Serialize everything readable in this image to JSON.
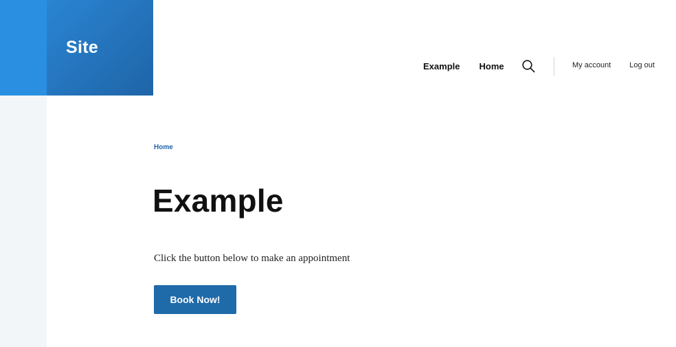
{
  "header": {
    "brand": "Site",
    "main_nav": [
      {
        "label": "Example"
      },
      {
        "label": "Home"
      }
    ],
    "search_icon": "search-icon",
    "account_nav": [
      {
        "label": "My account"
      },
      {
        "label": "Log out"
      }
    ]
  },
  "breadcrumb": {
    "home": "Home"
  },
  "main": {
    "title": "Example",
    "body": "Click the button below to make an appointment",
    "cta_label": "Book Now!"
  },
  "colors": {
    "brand_blue": "#2a85d2",
    "brand_dark": "#1f64a8",
    "button": "#1f6aa9",
    "gutter": "#f3f6f8"
  }
}
